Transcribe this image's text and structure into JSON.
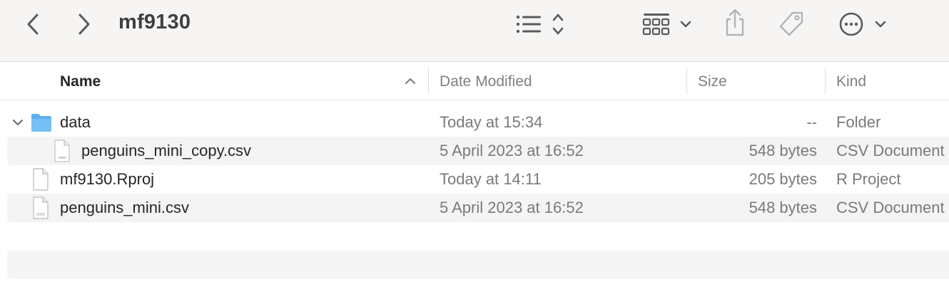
{
  "toolbar": {
    "title": "mf9130",
    "icons": [
      "back-icon",
      "forward-icon",
      "list-view-icon",
      "group-icon",
      "share-icon",
      "tag-icon",
      "more-icon"
    ]
  },
  "columns": {
    "name": "Name",
    "date": "Date Modified",
    "size": "Size",
    "kind": "Kind"
  },
  "rows": [
    {
      "name": "data",
      "date": "Today at 15:34",
      "size": "--",
      "kind": "Folder",
      "icon": "folder-icon",
      "expanded": true
    },
    {
      "name": "penguins_mini_copy.csv",
      "date": "5 April 2023 at 16:52",
      "size": "548 bytes",
      "kind": "CSV Document",
      "icon": "csv-file-icon"
    },
    {
      "name": "mf9130.Rproj",
      "date": "Today at 14:11",
      "size": "205 bytes",
      "kind": "R Project",
      "icon": "document-icon"
    },
    {
      "name": "penguins_mini.csv",
      "date": "5 April 2023 at 16:52",
      "size": "548 bytes",
      "kind": "CSV Document",
      "icon": "csv-file-icon"
    }
  ],
  "colors": {
    "toolbar_bg": "#f6f5f4",
    "folder": "#5fb0ef",
    "stripe": "#f4f4f4"
  }
}
